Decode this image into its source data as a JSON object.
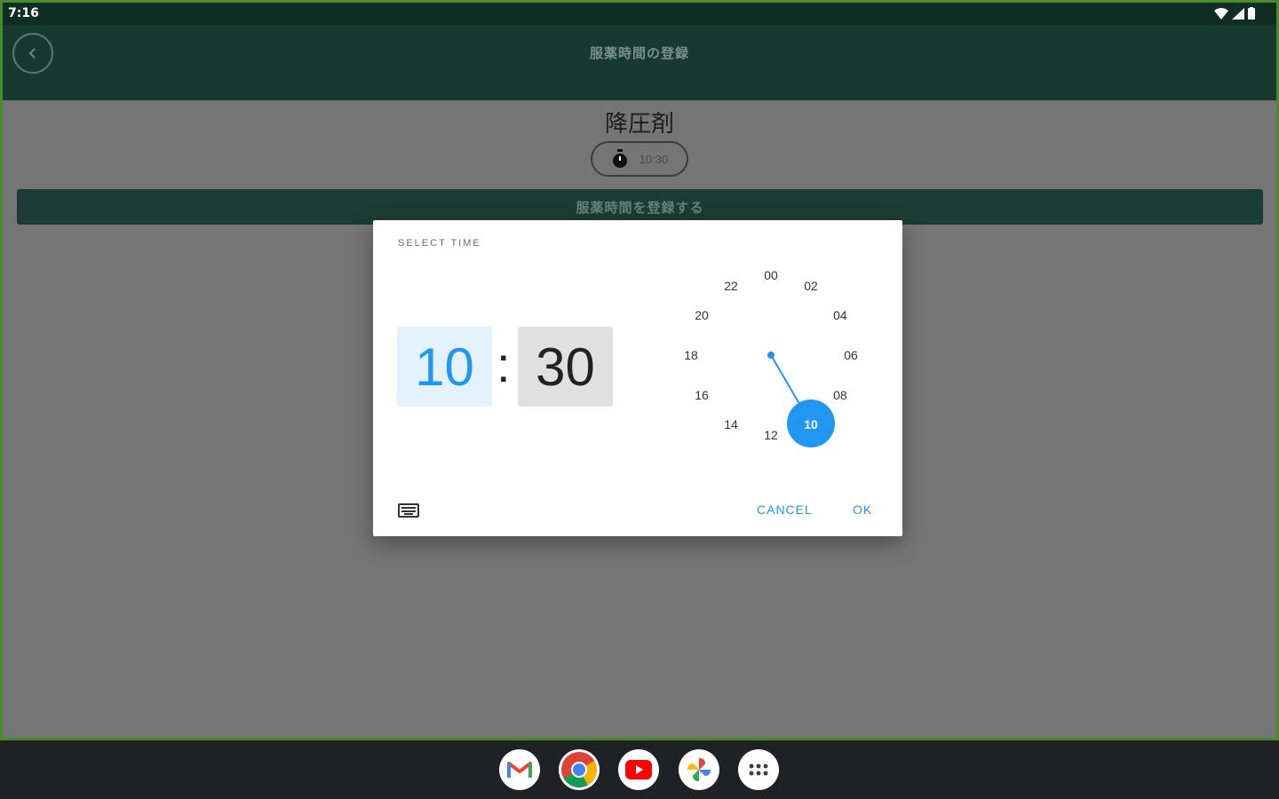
{
  "status_bar": {
    "time": "7:16"
  },
  "app_bar": {
    "title": "服薬時間の登録"
  },
  "medication": {
    "name": "降圧剤",
    "time": "10:30"
  },
  "register_button": {
    "label": "服薬時間を登録する"
  },
  "dialog": {
    "title": "SELECT TIME",
    "hour": "10",
    "separator": ":",
    "minute": "30",
    "selected_hour": "10",
    "clock_numbers": [
      "00",
      "02",
      "04",
      "06",
      "08",
      "10",
      "12",
      "14",
      "16",
      "18",
      "20",
      "22"
    ],
    "cancel_label": "CANCEL",
    "ok_label": "OK"
  },
  "colors": {
    "accent": "#2196f3",
    "app_bar": "#163a30",
    "scrim": "#757575",
    "taskbar": "#202124"
  },
  "taskbar": {
    "apps": [
      "gmail-icon",
      "chrome-icon",
      "youtube-icon",
      "photos-icon",
      "app-launcher-icon"
    ]
  }
}
